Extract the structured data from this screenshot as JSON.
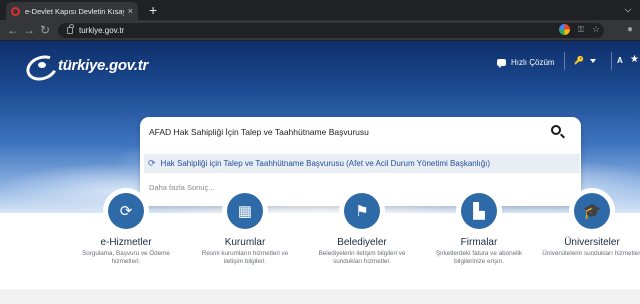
{
  "browser": {
    "tab_title": "e-Devlet Kapısı Devletin Kısayolu",
    "tab_close": "×",
    "new_tab": "+",
    "url": "turkiye.gov.tr",
    "back": "←",
    "forward": "→",
    "reload": "↻"
  },
  "header": {
    "logo_text": "türkiye.gov.tr",
    "quick_help": "Hızlı Çözüm",
    "login_icon": "🔑",
    "accessibility": "A",
    "favorites": "★"
  },
  "search": {
    "value": "AFAD Hak Sahipliği İçin Talep ve Taahhütname Başvurusu",
    "suggestion": "Hak Sahipliği için Talep ve Taahhütname Başvurusu (Afet ve Acil Durum Yönetimi Başkanlığı)",
    "more_results": "Daha fazla Sonuç..."
  },
  "categories": [
    {
      "title": "e-Hizmetler",
      "desc": "Sorgulama, Başvuru ve Ödeme hizmetleri.",
      "icon": "refresh-icon",
      "glyph": "⟳"
    },
    {
      "title": "Kurumlar",
      "desc": "Resmi kurumların hizmetleri ve iletişim bilgileri.",
      "icon": "building-icon",
      "glyph": "▦"
    },
    {
      "title": "Belediyeler",
      "desc": "Belediyelerin iletişim bilgileri ve sundukları hizmetler.",
      "icon": "signpost-icon",
      "glyph": "⚑"
    },
    {
      "title": "Firmalar",
      "desc": "Şirketlerdeki fatura ve abonelik bilgilerinize erişin.",
      "icon": "factory-icon",
      "glyph": "▙"
    },
    {
      "title": "Üniversiteler",
      "desc": "Üniversitelerin sundukları hizmetler.",
      "icon": "graduation-cap-icon",
      "glyph": "🎓"
    }
  ],
  "colors": {
    "accent": "#2f6aa8",
    "suggestion_text": "#234e9a",
    "chrome_dark": "#202124"
  }
}
